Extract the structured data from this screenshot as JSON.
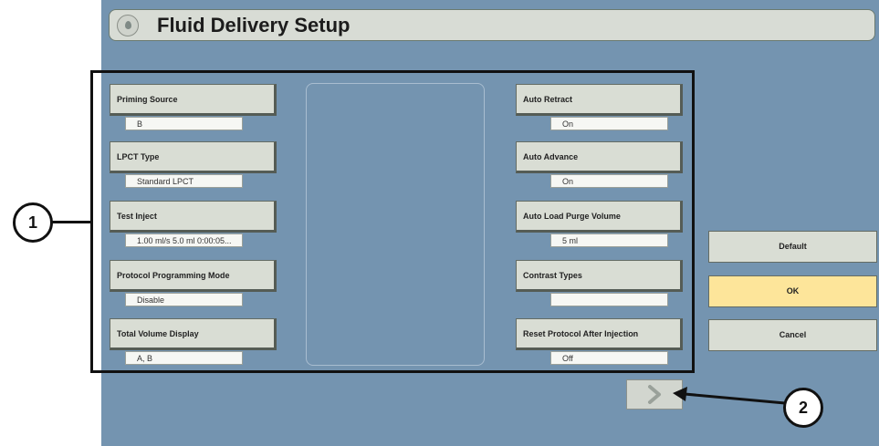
{
  "title": "Fluid Delivery Setup",
  "icons": {
    "title": "droplet-icon",
    "next": "chevron-right-icon"
  },
  "colors": {
    "background": "#7494b0",
    "button": "#d9ddd4",
    "ok_button": "#fde59a"
  },
  "left_settings": [
    {
      "label": "Priming Source",
      "value": "B"
    },
    {
      "label": "LPCT Type",
      "value": "Standard LPCT"
    },
    {
      "label": "Test Inject",
      "value": "1.00 ml/s 5.0 ml 0:00:05..."
    },
    {
      "label": "Protocol Programming Mode",
      "value": "Disable"
    },
    {
      "label": "Total Volume Display",
      "value": "A, B"
    }
  ],
  "right_settings": [
    {
      "label": "Auto Retract",
      "value": "On"
    },
    {
      "label": "Auto Advance",
      "value": "On"
    },
    {
      "label": "Auto Load Purge Volume",
      "value": "5 ml"
    },
    {
      "label": "Contrast Types",
      "value": ""
    },
    {
      "label": "Reset Protocol After Injection",
      "value": "Off"
    }
  ],
  "actions": {
    "default": "Default",
    "ok": "OK",
    "cancel": "Cancel"
  },
  "callouts": {
    "one": "1",
    "two": "2"
  }
}
